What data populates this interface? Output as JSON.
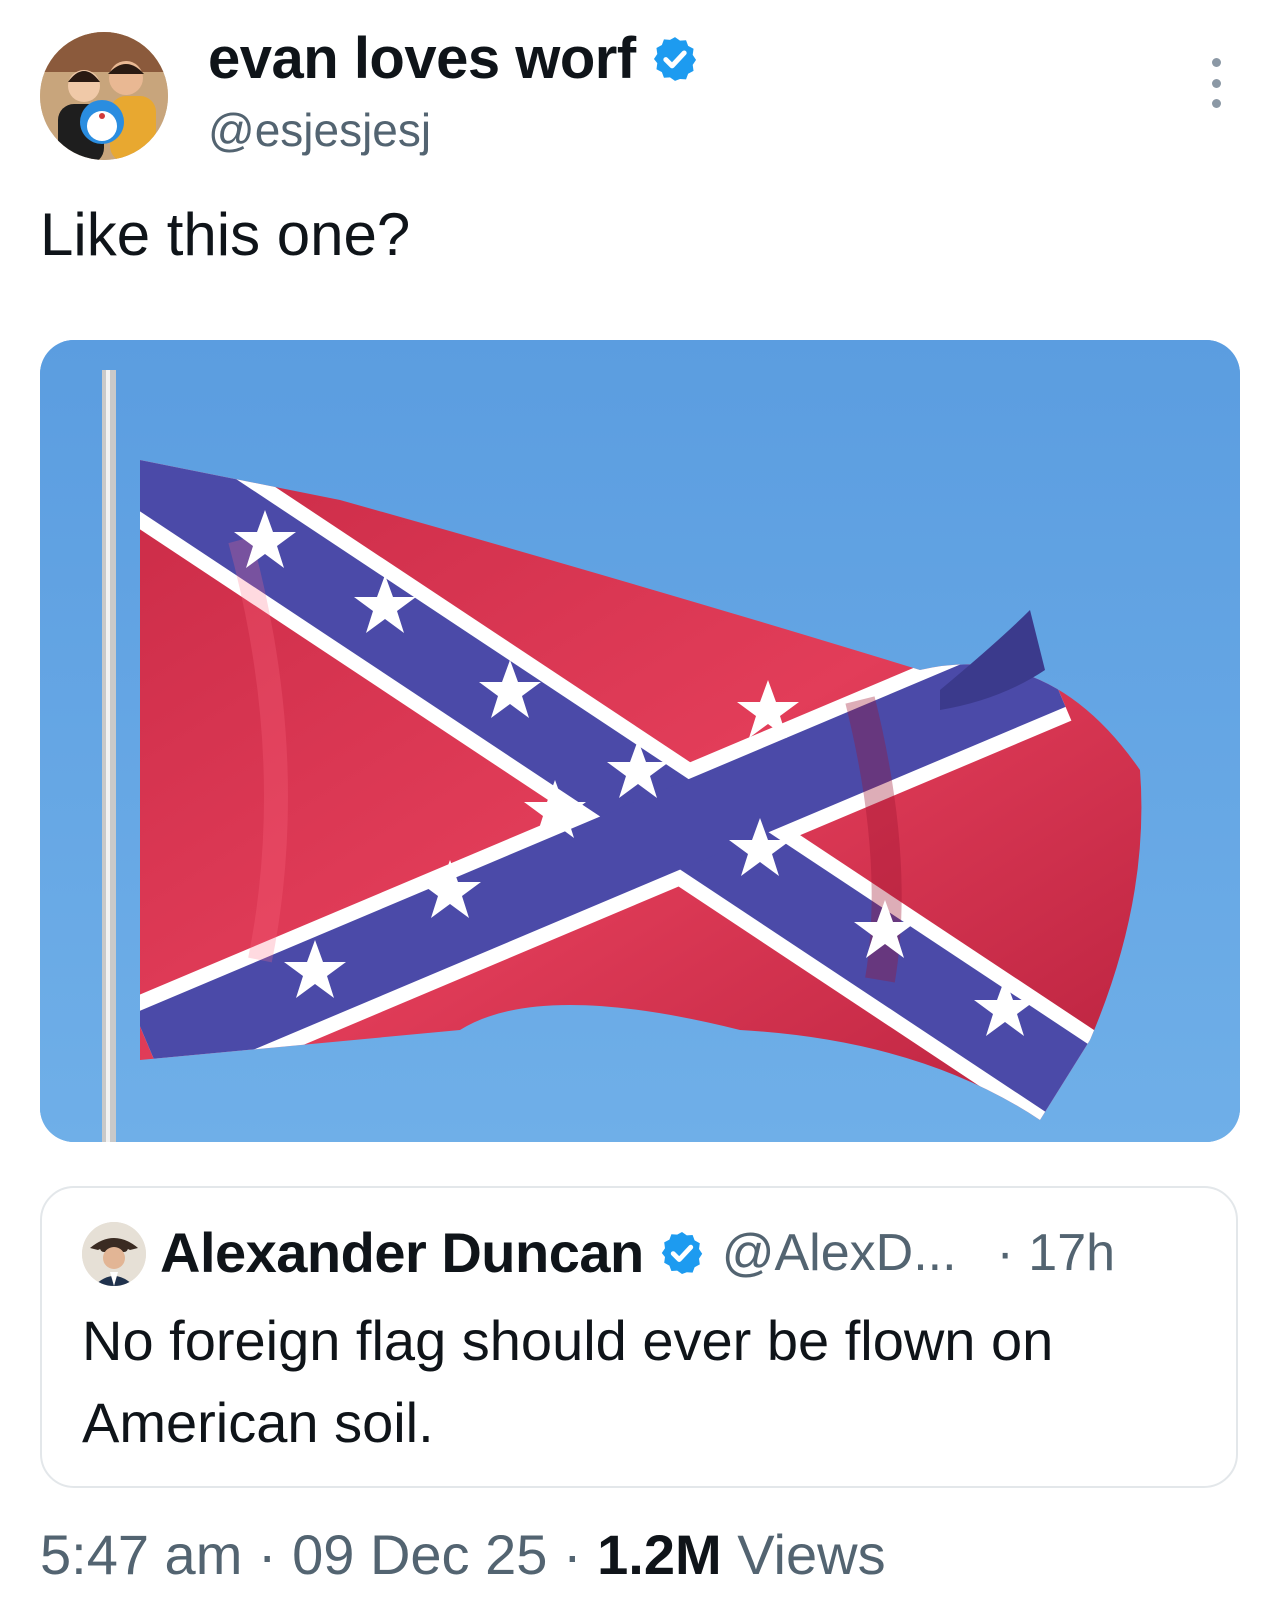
{
  "author": {
    "display_name": "evan loves worf",
    "handle": "@esjesjesj",
    "verified_icon": "verified-badge-icon",
    "verified_color": "#1d9bf0"
  },
  "tweet": {
    "text": "Like this one?",
    "media_image": "flag-photo"
  },
  "quoted_tweet": {
    "display_name": "Alexander Duncan",
    "handle": "@AlexD...",
    "time": "· 17h",
    "text": "No foreign flag should ever be flown on American soil."
  },
  "meta": {
    "time": "5:47 am",
    "sep1": " · ",
    "date": "09 Dec 25",
    "sep2": " · ",
    "views_count": "1.2M",
    "views_label": " Views"
  },
  "colors": {
    "text_primary": "#0f1419",
    "text_secondary": "#536471",
    "border": "#e3e7ea",
    "sky": "#5fa2e2",
    "flag_red": "#d8334f",
    "flag_blue": "#4b4aa8"
  }
}
